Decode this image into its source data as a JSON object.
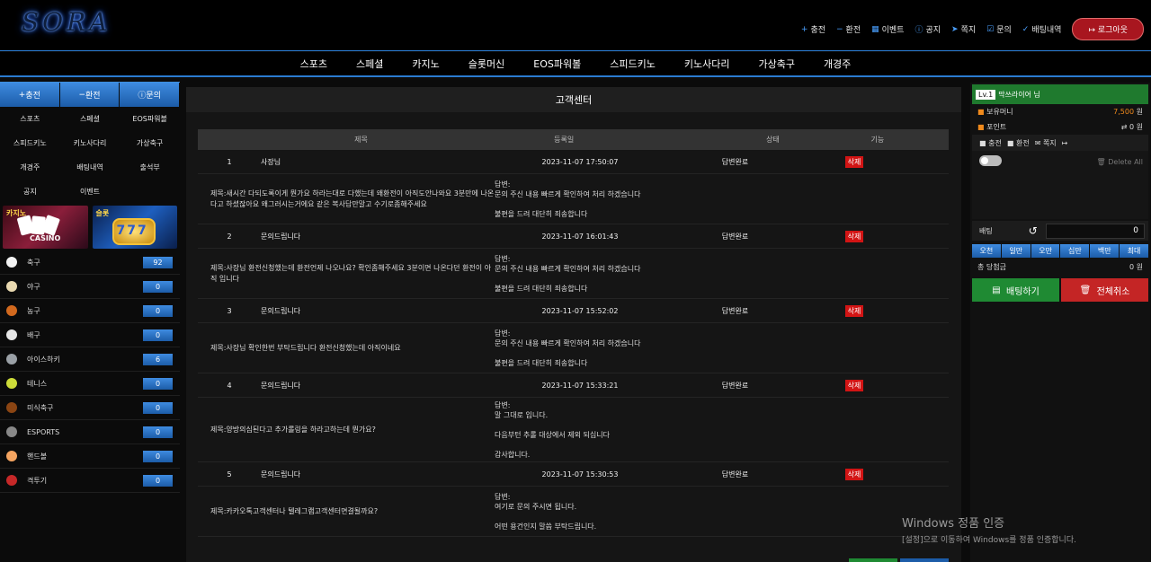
{
  "logo": "SORA",
  "topnav": [
    {
      "icon": "plus-icon",
      "label": "충전"
    },
    {
      "icon": "minus-icon",
      "label": "환전"
    },
    {
      "icon": "calendar-icon",
      "label": "이벤트"
    },
    {
      "icon": "info-icon",
      "label": "공지"
    },
    {
      "icon": "send-icon",
      "label": "쪽지"
    },
    {
      "icon": "check-square-icon",
      "label": "문의"
    },
    {
      "icon": "check-icon",
      "label": "배팅내역"
    }
  ],
  "logout": "로그아웃",
  "mainnav": [
    "스포츠",
    "스페셜",
    "카지노",
    "슬롯머신",
    "EOS파워볼",
    "스피드키노",
    "키노사다리",
    "가상축구",
    "개경주"
  ],
  "left": {
    "tabs": [
      "충전",
      "환전",
      "문의"
    ],
    "grid": [
      "스포츠",
      "스페셜",
      "EOS파워볼",
      "스피드키노",
      "키노사다리",
      "가상축구",
      "개경주",
      "배팅내역",
      "출석부",
      "공지",
      "이벤트"
    ],
    "banner_casino": "카지노",
    "banner_casino_text": "CASINO",
    "banner_slot": "슬롯",
    "banner_slot_text": "777",
    "sports": [
      {
        "name": "축구",
        "count": "92",
        "color": "#f2f2f2"
      },
      {
        "name": "야구",
        "count": "0",
        "color": "#e9d9b0"
      },
      {
        "name": "농구",
        "count": "0",
        "color": "#d2691e"
      },
      {
        "name": "배구",
        "count": "0",
        "color": "#e6e6e6"
      },
      {
        "name": "아이스하키",
        "count": "6",
        "color": "#9aa0a6"
      },
      {
        "name": "테니스",
        "count": "0",
        "color": "#cddc39"
      },
      {
        "name": "미식축구",
        "count": "0",
        "color": "#8b4513"
      },
      {
        "name": "ESPORTS",
        "count": "0",
        "color": "#888888"
      },
      {
        "name": "핸드볼",
        "count": "0",
        "color": "#f4a460"
      },
      {
        "name": "격투기",
        "count": "0",
        "color": "#c62828"
      }
    ]
  },
  "center": {
    "title": "고객센터",
    "headers": [
      "제목",
      "등록일",
      "상태",
      "기능"
    ],
    "rows": [
      {
        "num": "1",
        "title": "사장님",
        "date": "2023-11-07 17:50:07",
        "state": "답변완료",
        "del": "삭제",
        "q": "제목:새시간 다되도록이게 뭔가요 하라는대로 다했는데 왜환전이 아직도안나와요 3분만에 나온다고 하셨잖아요 왜그러시는거에요 같은 복사답만말고 수기로좀해주세요",
        "a": [
          "답변:",
          "문의 주신 내용 빠르게 확인하여 처리 하겠습니다",
          "",
          "불편을 드려 대단히 죄송합니다"
        ]
      },
      {
        "num": "2",
        "title": "문의드립니다",
        "date": "2023-11-07 16:01:43",
        "state": "답변완료",
        "del": "삭제",
        "q": "제목:사장님 환전신청했는데 환전언제 나오나요? 확인좀해주세요 3분이면 나온다던 환전이 아직 입니다",
        "a": [
          "답변:",
          "문의 주신 내용 빠르게 확인하여 처리 하겠습니다",
          "",
          "불편을 드려 대단히 죄송합니다"
        ]
      },
      {
        "num": "3",
        "title": "문의드립니다",
        "date": "2023-11-07 15:52:02",
        "state": "답변완료",
        "del": "삭제",
        "q": "제목:사장님 확인한번 부탁드립니다 환전신청했는데 아직이네요",
        "a": [
          "답변:",
          "문의 주신 내용 빠르게 확인하여 처리 하겠습니다",
          "",
          "불편을 드려 대단히 죄송합니다"
        ]
      },
      {
        "num": "4",
        "title": "문의드립니다",
        "date": "2023-11-07 15:33:21",
        "state": "답변완료",
        "del": "삭제",
        "q": "제목:양방의심된다고 추가롤링을 하라고하는데 뭔가요?",
        "a": [
          "답변:",
          "말 그대로 입니다.",
          "",
          "다음부턴 추롤 대상에서 제외 되십니다",
          "",
          "감사합니다."
        ]
      },
      {
        "num": "5",
        "title": "문의드립니다",
        "date": "2023-11-07 15:30:53",
        "state": "답변완료",
        "del": "삭제",
        "q": "제목:카카오톡고객센터나 텔레그램고객센터면결될까요?",
        "a": [
          "답변:",
          "여기로 문의 주시면 됩니다.",
          "",
          "어떤 용건인지 말씀 부탁드립니다."
        ]
      }
    ]
  },
  "right": {
    "level": "Lv.1",
    "user": "막쓰라이어 님",
    "money_label": "보유머니",
    "money": "7,500",
    "money_unit": "원",
    "point_label": "포인트",
    "point": "0",
    "point_unit": "원",
    "btns": [
      "충전",
      "환전",
      "쪽지"
    ],
    "delete_all": "Delete All",
    "bet_label": "배팅",
    "bet_value": "0",
    "quick": [
      "오천",
      "일만",
      "오만",
      "십만",
      "백만",
      "최대"
    ],
    "total_label": "총 당첨금",
    "total": "0 원",
    "bet_btn": "배팅하기",
    "cancel_btn": "전체취소"
  },
  "watermark": {
    "line1": "Windows 정품 인증",
    "line2": "[설정]으로 이동하여 Windows를 정품 인증합니다."
  }
}
